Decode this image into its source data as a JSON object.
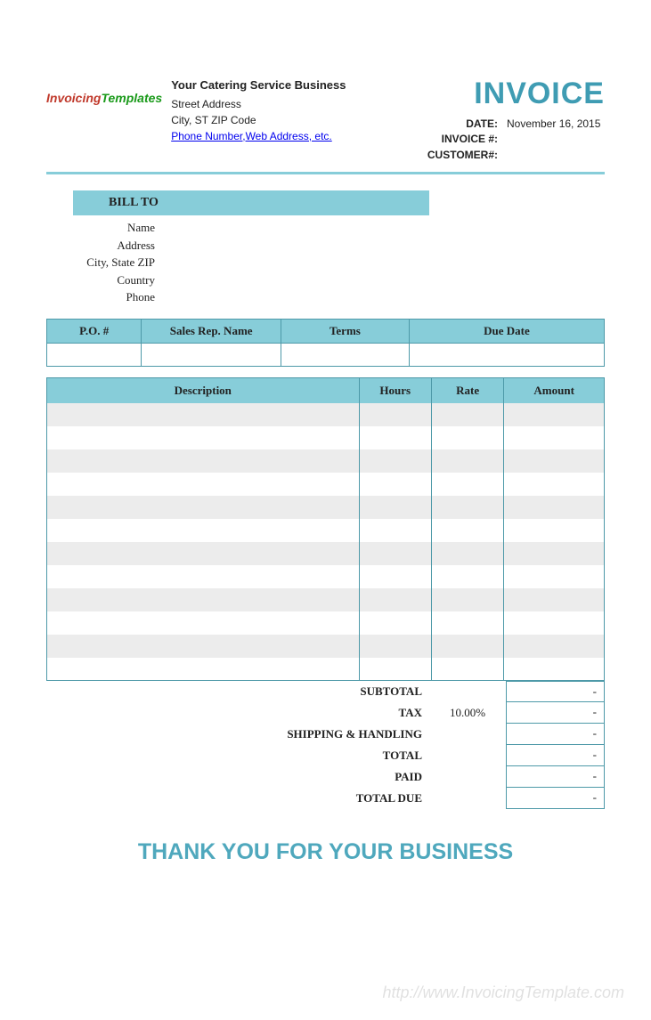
{
  "logo": {
    "part1": "Invoicing",
    "part2": "Templates"
  },
  "company": {
    "name": "Your Catering  Service Business",
    "street": "Street Address",
    "city": "City, ST  ZIP Code",
    "contact": "Phone Number,Web Address, etc."
  },
  "title": "INVOICE",
  "meta": {
    "date_label": "DATE:",
    "date_value": "November 16, 2015",
    "invnum_label": "INVOICE #:",
    "invnum_value": "",
    "cust_label": "CUSTOMER#:",
    "cust_value": ""
  },
  "billto": {
    "heading": "BILL TO",
    "labels": [
      "Name",
      "Address",
      "City, State ZIP",
      "Country",
      "Phone"
    ]
  },
  "t1": {
    "headers": [
      "P.O. #",
      "Sales Rep. Name",
      "Terms",
      "Due Date"
    ],
    "row": [
      "",
      "",
      "",
      ""
    ]
  },
  "t2": {
    "headers": [
      "Description",
      "Hours",
      "Rate",
      "Amount"
    ],
    "rows": 12
  },
  "totals": {
    "subtotal": {
      "label": "SUBTOTAL",
      "value": "-"
    },
    "tax": {
      "label": "TAX",
      "rate": "10.00%",
      "value": "-"
    },
    "ship": {
      "label": "SHIPPING & HANDLING",
      "value": "-"
    },
    "total": {
      "label": "TOTAL",
      "value": "-"
    },
    "paid": {
      "label": "PAID",
      "value": "-"
    },
    "due": {
      "label": "TOTAL DUE",
      "value": "-"
    }
  },
  "thanks": "THANK YOU FOR YOUR BUSINESS",
  "watermark": "http://www.InvoicingTemplate.com"
}
